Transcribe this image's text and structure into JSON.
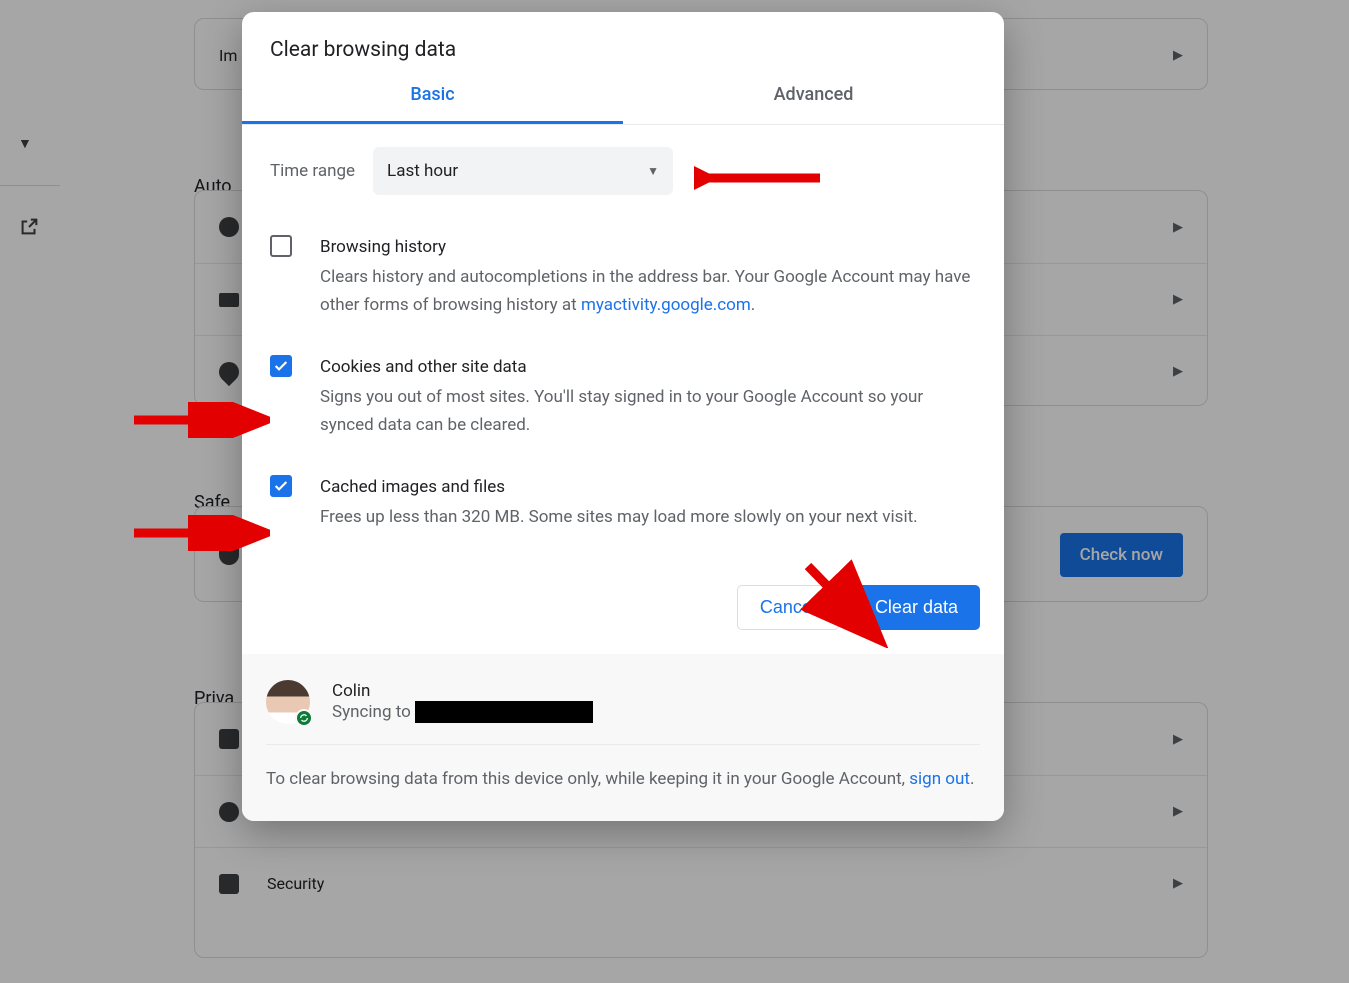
{
  "modal": {
    "title": "Clear browsing data",
    "tabs": {
      "basic": "Basic",
      "advanced": "Advanced"
    },
    "time_range": {
      "label": "Time range",
      "value": "Last hour"
    },
    "options": {
      "history": {
        "checked": false,
        "heading": "Browsing history",
        "desc": "Clears history and autocompletions in the address bar. Your Google Account may have other forms of browsing history at ",
        "link_text": "myactivity.google.com",
        "after_link": "."
      },
      "cookies": {
        "checked": true,
        "heading": "Cookies and other site data",
        "desc": "Signs you out of most sites. You'll stay signed in to your Google Account so your synced data can be cleared."
      },
      "cache": {
        "checked": true,
        "heading": "Cached images and files",
        "desc": "Frees up less than 320 MB. Some sites may load more slowly on your next visit."
      }
    },
    "actions": {
      "cancel": "Cancel",
      "clear": "Clear data"
    },
    "sync": {
      "name": "Colin",
      "status_prefix": "Syncing to"
    },
    "footer_note_prefix": "To clear browsing data from this device only, while keeping it in your Google Account, ",
    "footer_note_link": "sign out",
    "footer_note_suffix": "."
  },
  "background": {
    "import_row": "Im",
    "autofill_label": "Auto",
    "safety_label": "Safe",
    "safety_check_btn": "Check now",
    "privacy_label": "Priva",
    "security_row": "Security"
  }
}
